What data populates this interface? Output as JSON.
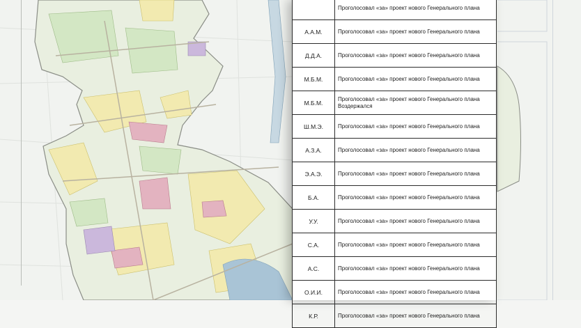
{
  "document": {
    "rows": [
      {
        "initials": "",
        "status": [
          "Проголосовал «за» проект нового Генерального плана"
        ]
      },
      {
        "initials": "А.А.М.",
        "status": [
          "Проголосовал «за» проект нового Генерального плана"
        ]
      },
      {
        "initials": "Д.Д.А.",
        "status": [
          "Проголосовал «за» проект нового Генерального плана"
        ]
      },
      {
        "initials": "М.Б.М.",
        "status": [
          "Проголосовал «за» проект нового Генерального плана"
        ]
      },
      {
        "initials": "М.Б.М.",
        "status": [
          "Проголосовал «за» проект нового Генерального плана",
          "Воздержался"
        ]
      },
      {
        "initials": "Ш.М.Э.",
        "status": [
          "Проголосовал «за» проект нового Генерального плана"
        ]
      },
      {
        "initials": "А.З.А.",
        "status": [
          "Проголосовал «за» проект нового Генерального плана"
        ]
      },
      {
        "initials": "Э.А.Э.",
        "status": [
          "Проголосовал «за» проект нового Генерального плана"
        ]
      },
      {
        "initials": "Б.А.",
        "status": [
          "Проголосовал «за» проект нового Генерального плана"
        ]
      },
      {
        "initials": "У.У.",
        "status": [
          "Проголосовал «за» проект нового Генерального плана"
        ]
      },
      {
        "initials": "С.А.",
        "status": [
          "Проголосовал «за» проект нового Генерального плана"
        ]
      },
      {
        "initials": "А.С.",
        "status": [
          "Проголосовал «за» проект нового Генерального плана"
        ]
      },
      {
        "initials": "О.И.И.",
        "status": [
          "Проголосовал «за» проект нового Генерального плана"
        ]
      },
      {
        "initials": "К.Р.",
        "status": [
          "Проголосовал «за» проект нового Генерального плана"
        ]
      }
    ]
  },
  "colors": {
    "table_border": "#2b2b2b",
    "map_base": "#f1f3f0",
    "zone_yellow": "#f3ecb0",
    "zone_green": "#dcebd0",
    "zone_pink": "#e6b8c4",
    "water": "#a9c4d6"
  }
}
